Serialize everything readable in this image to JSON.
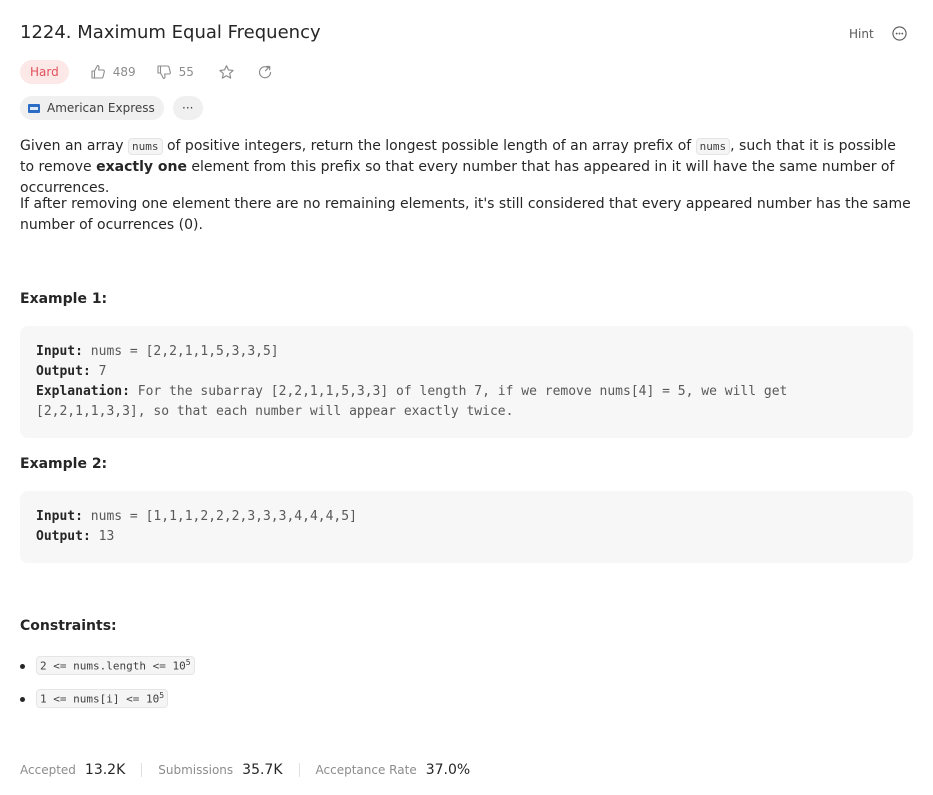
{
  "problem": {
    "title": "1224. Maximum Equal Frequency",
    "hint_label": "Hint",
    "difficulty": "Hard",
    "likes": "489",
    "dislikes": "55",
    "company": "American Express",
    "more_label": "···"
  },
  "description": {
    "p1_a": "Given an array ",
    "p1_code1": "nums",
    "p1_b": " of positive integers, return the longest possible length of an array prefix of ",
    "p1_code2": "nums",
    "p1_c": ", such that it is possible to remove ",
    "p1_bold": "exactly one",
    "p1_d": " element from this prefix so that every number that has appeared in it will have the same number of occurrences.",
    "p2": "If after removing one element there are no remaining elements, it's still considered that every appeared number has the same number of ocurrences (0)."
  },
  "examples": [
    {
      "heading": "Example 1:",
      "input_label": "Input:",
      "input": "nums = [2,2,1,1,5,3,3,5]",
      "output_label": "Output:",
      "output": "7",
      "explanation_label": "Explanation:",
      "explanation_line1": "For the subarray [2,2,1,1,5,3,3] of length 7, if we remove nums[4] = 5, we will get",
      "explanation_line2": "[2,2,1,1,3,3], so that each number will appear exactly twice."
    },
    {
      "heading": "Example 2:",
      "input_label": "Input:",
      "input": "nums = [1,1,1,2,2,2,3,3,3,4,4,4,5]",
      "output_label": "Output:",
      "output": "13"
    }
  ],
  "constraints": {
    "heading": "Constraints:",
    "items": [
      {
        "text": "2 <= nums.length <= 10",
        "sup": "5"
      },
      {
        "text": "1 <= nums[i] <= 10",
        "sup": "5"
      }
    ]
  },
  "stats": {
    "accepted_label": "Accepted",
    "accepted": "13.2K",
    "submissions_label": "Submissions",
    "submissions": "35.7K",
    "rate_label": "Acceptance Rate",
    "rate": "37.0%"
  },
  "icons": {
    "like": "thumbs-up-icon",
    "dislike": "thumbs-down-icon",
    "star": "star-icon",
    "share": "share-icon",
    "more": "more-icon",
    "company": "american-express-logo"
  },
  "colors": {
    "hard_text": "#e0515c",
    "hard_bg": "#fde8e8",
    "code_bg": "#f7f7f8"
  }
}
